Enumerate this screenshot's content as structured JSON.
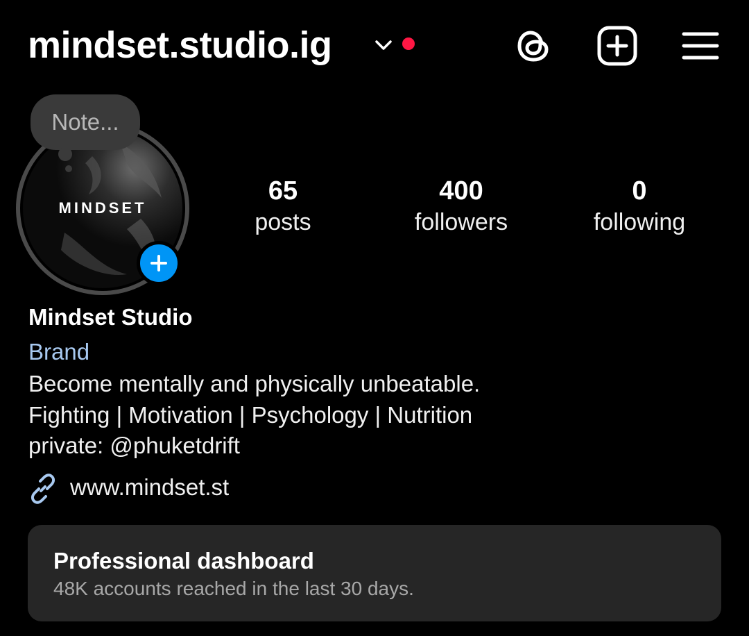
{
  "header": {
    "username": "mindset.studio.ig",
    "has_notification_dot": true,
    "icons": [
      "threads-icon",
      "create-post-icon",
      "menu-icon"
    ]
  },
  "profile": {
    "note_placeholder": "Note...",
    "avatar_logo_text": "MINDSET",
    "stats": {
      "posts": {
        "value": "65",
        "label": "posts"
      },
      "followers": {
        "value": "400",
        "label": "followers"
      },
      "following": {
        "value": "0",
        "label": "following"
      }
    },
    "display_name": "Mindset Studio",
    "category": "Brand",
    "bio_lines": [
      "Become mentally and physically unbeatable.",
      "Fighting | Motivation | Psychology | Nutrition",
      "private: @phuketdrift"
    ],
    "link": "www.mindset.st"
  },
  "dashboard": {
    "title": "Professional dashboard",
    "subtitle": "48K accounts reached in the last 30 days."
  },
  "colors": {
    "background": "#000000",
    "accent_blue": "#0095f6",
    "notification_red": "#ff1744",
    "card": "#262626",
    "muted_text": "#a8a8a8"
  }
}
